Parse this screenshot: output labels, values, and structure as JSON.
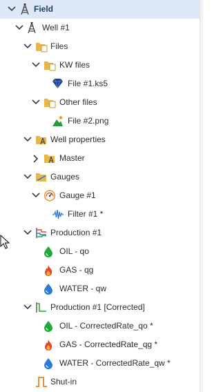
{
  "tree": {
    "root": "Field",
    "well": "Well #1",
    "files": "Files",
    "kw_files": "KW files",
    "file1": "File #1.ks5",
    "other_files": "Other files",
    "file2": "File #2.png",
    "well_properties": "Well properties",
    "master": "Master",
    "gauges": "Gauges",
    "gauge1": "Gauge #1",
    "filter1": "Filter #1 *",
    "production1": "Production #1",
    "oil": "OIL - qo",
    "gas": "GAS - qg",
    "water": "WATER - qw",
    "production1_corrected": "Production #1 [Corrected]",
    "oil_corrected": "OIL - CorrectedRate_qo *",
    "gas_corrected": "GAS - CorrectedRate_qg *",
    "water_corrected": "WATER - CorrectedRate_qw *",
    "shutin": "Shut-in"
  },
  "colors": {
    "selected_row": "#dde9f6",
    "folder": "#e8b64a",
    "oil": "#22a83a",
    "gas": "#e8462a",
    "water": "#2d7ad6",
    "diamond": "#1e3f8c"
  }
}
